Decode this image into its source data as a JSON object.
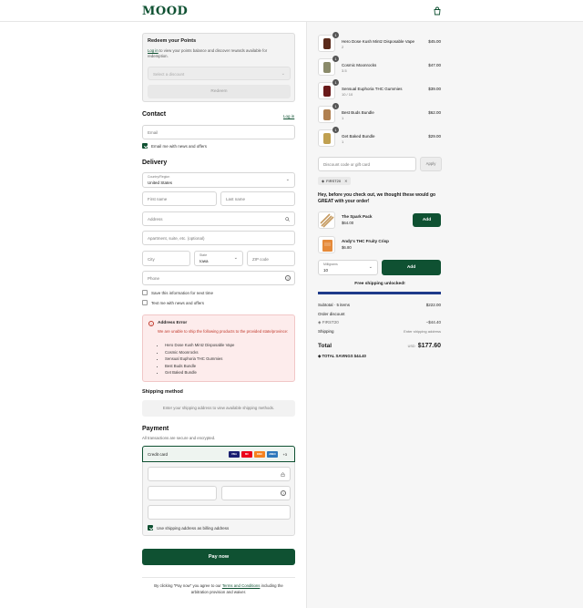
{
  "brand": {
    "logo": "MOOD",
    "accent": "#0f5132"
  },
  "redeem": {
    "title": "Redeem your Points",
    "login_link": "Log in",
    "desc_after_link": " to view your points balance and discover rewards available for redemption.",
    "select_placeholder": "Select a discount",
    "button": "Redeem"
  },
  "contact": {
    "title": "Contact",
    "login_link": "Log in",
    "email_placeholder": "Email",
    "newsletter_label": "Email me with news and offers",
    "newsletter_checked": true
  },
  "delivery": {
    "title": "Delivery",
    "country_label": "Country/Region",
    "country_value": "United States",
    "first_name": "First name",
    "last_name": "Last name",
    "address": "Address",
    "apartment": "Apartment, suite, etc. (optional)",
    "city": "City",
    "state_label": "State",
    "state_value": "Iowa",
    "zip": "ZIP code",
    "phone": "Phone",
    "save_info": "Save this information for next time",
    "text_me": "Text me with news and offers"
  },
  "address_error": {
    "title": "Address Error",
    "message": "We are unable to ship the following products to the provided state/province:",
    "items": [
      "Hero Dose Kush Mintz Disposable Vape",
      "Cosmic Moonrocks",
      "Sensual Euphoria THC Gummies",
      "Best Buds Bundle",
      "Get Baked Bundle"
    ]
  },
  "shipping_method": {
    "title": "Shipping method",
    "placeholder": "Enter your shipping address to view available shipping methods."
  },
  "payment": {
    "title": "Payment",
    "subtitle": "All transactions are secure and encrypted.",
    "credit_card": "Credit card",
    "cards": [
      "VISA",
      "MC",
      "DISC",
      "AMEX"
    ],
    "more_cards": "+3",
    "billing_label": "Use shipping address as billing address",
    "pay_button": "Pay now",
    "terms_prefix": "By clicking \"Pay now\" you agree to our ",
    "terms_link": "Terms and Conditions",
    "terms_suffix": " including the arbitration provision and waiver."
  },
  "cart": {
    "items": [
      {
        "name": "Hero Dose Kush Mintz Disposable Vape",
        "variant": "2",
        "price": "$45.00",
        "qty": "1",
        "icon": "vape-icon"
      },
      {
        "name": "Cosmic Moonrocks",
        "variant": "3.5",
        "price": "$47.00",
        "qty": "1",
        "icon": "moonrocks-icon"
      },
      {
        "name": "Sensual Euphoria THC Gummies",
        "variant": "10 / 10",
        "price": "$39.00",
        "qty": "1",
        "icon": "gummies-icon"
      },
      {
        "name": "Best Buds Bundle",
        "variant": "1",
        "price": "$62.00",
        "qty": "1",
        "icon": "bundle-icon"
      },
      {
        "name": "Get Baked Bundle",
        "variant": "1",
        "price": "$29.00",
        "qty": "1",
        "icon": "bundle-icon"
      }
    ],
    "discount_placeholder": "Discount code or gift card",
    "apply_button": "Apply",
    "applied_code": "FIRST20"
  },
  "upsell": {
    "heading": "Hey, before you check out, we thought these would go GREAT with your order!",
    "products": [
      {
        "name": "The Spark Pack",
        "price": "$64.00",
        "button": "Add"
      },
      {
        "name": "Andy's THC Fruity Crisp",
        "price": "$6.80"
      }
    ],
    "select_label": "Milligrams",
    "select_value": "10",
    "add_button": "Add"
  },
  "free_shipping": {
    "label": "Free shipping unlocked!",
    "progress": 1.0
  },
  "summary": {
    "subtotal_label": "Subtotal · 5 items",
    "subtotal_value": "$222.00",
    "order_discount_label": "Order discount",
    "discount_code": "FIRST20",
    "discount_value": "−$44.40",
    "shipping_label": "Shipping",
    "shipping_value": "Enter shipping address",
    "total_label": "Total",
    "currency": "USD",
    "total_value": "$177.60",
    "savings_label": "TOTAL SAVINGS",
    "savings_value": "$44.40"
  }
}
